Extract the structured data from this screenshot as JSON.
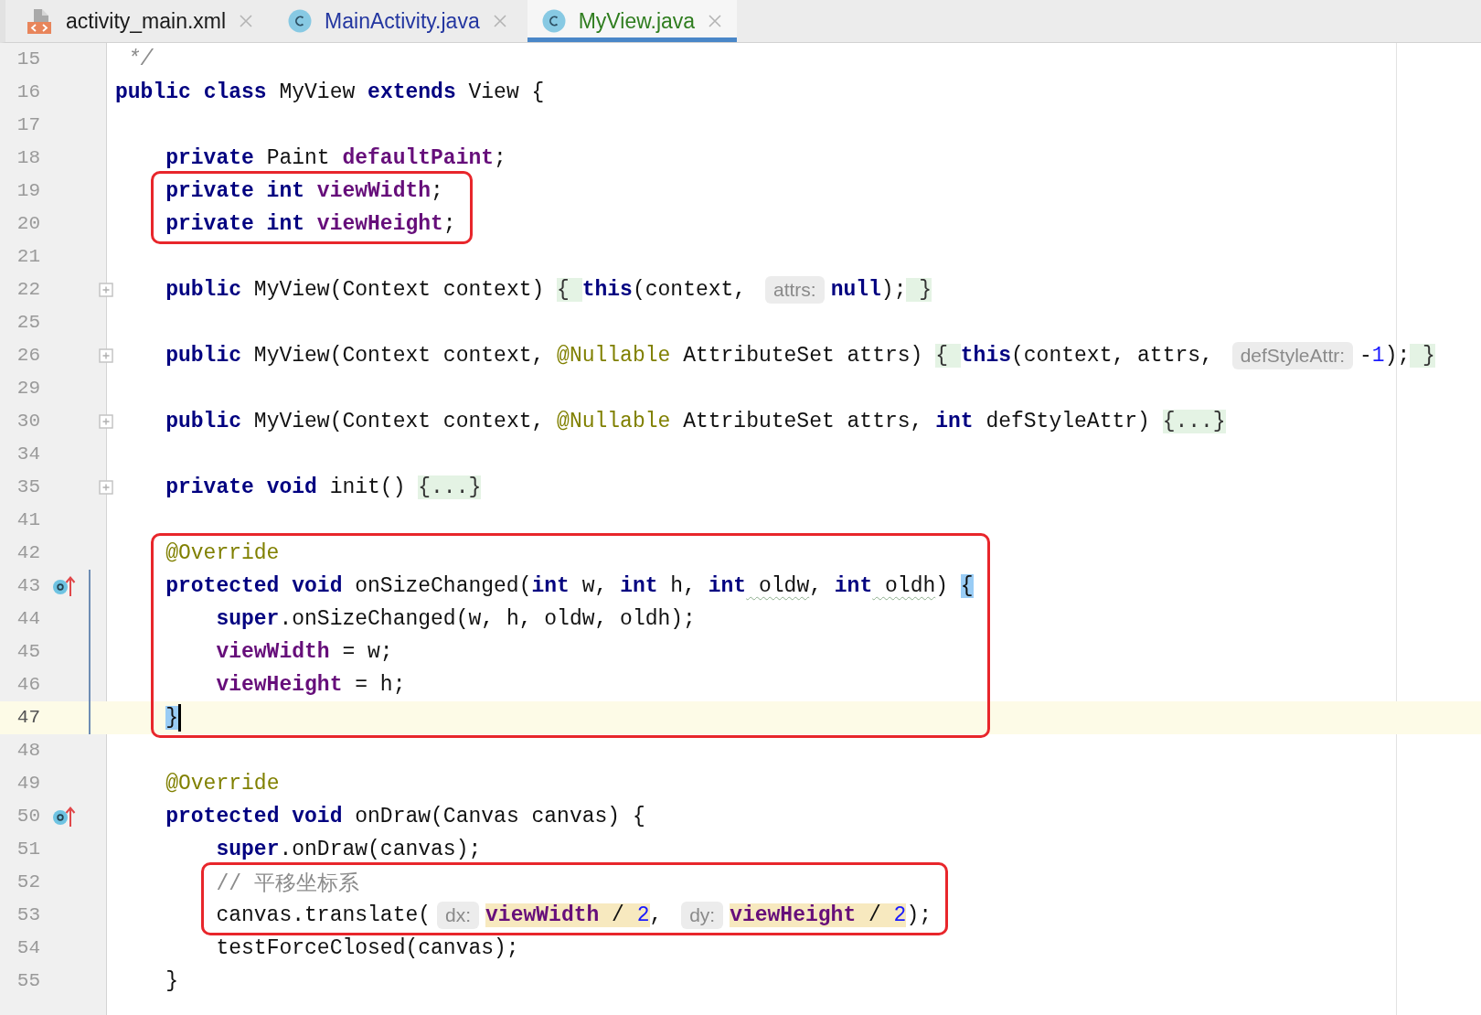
{
  "tabs": [
    {
      "label": "activity_main.xml",
      "kind": "layout",
      "color": "#1a1a1a",
      "selected": false
    },
    {
      "label": "MainActivity.java",
      "kind": "class",
      "color": "#2336a0",
      "selected": false
    },
    {
      "label": "MyView.java",
      "kind": "class",
      "color": "#2f7d1f",
      "selected": true
    }
  ],
  "blocks": [
    {
      "kind": "plain",
      "lines": [
        {
          "number": "15",
          "kind": "fold_end",
          "tokens": [
            {
              "kind": "doc_comment",
              "text": " */"
            }
          ]
        },
        {
          "number": "16",
          "tokens": [
            {
              "kind": "keyword",
              "text": "public"
            },
            {
              "kind": "keyword",
              "text": " class"
            },
            {
              "kind": "plain",
              "text": " MyView "
            },
            {
              "kind": "keyword",
              "text": "extends"
            },
            {
              "kind": "plain",
              "text": " View {"
            }
          ]
        },
        {
          "number": "17"
        },
        {
          "number": "18",
          "tokens": [
            {
              "kind": "keyword",
              "text": "    private"
            },
            {
              "kind": "plain",
              "text": " Paint "
            },
            {
              "kind": "field",
              "text": "defaultPaint"
            },
            {
              "kind": "plain",
              "text": ";"
            }
          ]
        }
      ]
    },
    {
      "kind": "boxed_member",
      "lines": [
        {
          "number": "19",
          "tokens": [
            {
              "kind": "keyword",
              "text": "private int"
            },
            {
              "kind": "field",
              "text": " viewWidth"
            },
            {
              "kind": "plain",
              "text": ";"
            }
          ]
        },
        {
          "number": "20",
          "tokens": [
            {
              "kind": "keyword",
              "text": "private int"
            },
            {
              "kind": "field",
              "text": " viewHeight"
            },
            {
              "kind": "plain",
              "text": ";"
            }
          ]
        }
      ]
    },
    {
      "kind": "plain",
      "lines": [
        {
          "number": "21"
        },
        {
          "number": "22",
          "kind": "collapsed",
          "tokens": [
            {
              "kind": "keyword",
              "text": "    public"
            },
            {
              "kind": "plain",
              "text": " MyView(Context context) "
            },
            {
              "kind": "fold",
              "text": "{ "
            },
            {
              "kind": "keyword",
              "text": "this"
            },
            {
              "kind": "plain",
              "text": "(context, "
            },
            {
              "kind": "hint",
              "text": "attrs:"
            },
            {
              "kind": "keyword",
              "text": "null"
            },
            {
              "kind": "plain",
              "text": ");"
            },
            {
              "kind": "fold",
              "text": " }"
            }
          ]
        },
        {
          "number": "25"
        },
        {
          "number": "26",
          "kind": "collapsed",
          "tokens": [
            {
              "kind": "keyword",
              "text": "    public"
            },
            {
              "kind": "plain",
              "text": " MyView(Context context, "
            },
            {
              "kind": "annotation",
              "text": "@Nullable"
            },
            {
              "kind": "plain",
              "text": " AttributeSet attrs) "
            },
            {
              "kind": "fold",
              "text": "{ "
            },
            {
              "kind": "keyword",
              "text": "this"
            },
            {
              "kind": "plain",
              "text": "(context, attrs, "
            },
            {
              "kind": "hint",
              "text": "defStyleAttr:"
            },
            {
              "kind": "plain",
              "text": "-"
            },
            {
              "kind": "number",
              "text": "1"
            },
            {
              "kind": "plain",
              "text": ");"
            },
            {
              "kind": "fold",
              "text": " }"
            }
          ]
        },
        {
          "number": "29"
        },
        {
          "number": "30",
          "kind": "collapsed",
          "tokens": [
            {
              "kind": "keyword",
              "text": "    public"
            },
            {
              "kind": "plain",
              "text": " MyView(Context context, "
            },
            {
              "kind": "annotation",
              "text": "@Nullable"
            },
            {
              "kind": "plain",
              "text": " AttributeSet attrs, "
            },
            {
              "kind": "keyword",
              "text": "int"
            },
            {
              "kind": "plain",
              "text": " defStyleAttr) "
            },
            {
              "kind": "fold",
              "text": "{...}"
            }
          ]
        },
        {
          "number": "34"
        },
        {
          "number": "35",
          "kind": "collapsed",
          "tokens": [
            {
              "kind": "keyword",
              "text": "    private void"
            },
            {
              "kind": "plain",
              "text": " init() "
            },
            {
              "kind": "fold",
              "text": "{...}"
            }
          ]
        },
        {
          "number": "41"
        }
      ]
    },
    {
      "kind": "boxed_member",
      "lines": [
        {
          "number": "42",
          "tokens": [
            {
              "kind": "annotation",
              "text": "@Override"
            }
          ]
        },
        {
          "number": "43",
          "kind": "fold_start",
          "override": true,
          "changed": true,
          "tokens": [
            {
              "kind": "keyword",
              "text": "protected void"
            },
            {
              "kind": "plain",
              "text": " onSizeChanged("
            },
            {
              "kind": "keyword",
              "text": "int"
            },
            {
              "kind": "plain",
              "text": " w, "
            },
            {
              "kind": "keyword",
              "text": "int"
            },
            {
              "kind": "plain",
              "text": " h, "
            },
            {
              "kind": "keyword",
              "text": "int"
            },
            {
              "kind": "typo",
              "text": " oldw"
            },
            {
              "kind": "plain",
              "text": ", "
            },
            {
              "kind": "keyword",
              "text": "int"
            },
            {
              "kind": "typo",
              "text": " oldh"
            },
            {
              "kind": "plain",
              "text": ") "
            },
            {
              "kind": "brace_match",
              "text": "{"
            }
          ]
        },
        {
          "number": "44",
          "changed": true,
          "tokens": [
            {
              "kind": "keyword",
              "text": "    super"
            },
            {
              "kind": "plain",
              "text": ".onSizeChanged(w, h, oldw, oldh);"
            }
          ]
        },
        {
          "number": "45",
          "changed": true,
          "tokens": [
            {
              "kind": "field",
              "text": "    viewWidth"
            },
            {
              "kind": "plain",
              "text": " = w;"
            }
          ]
        },
        {
          "number": "46",
          "changed": true,
          "tokens": [
            {
              "kind": "field",
              "text": "    viewHeight"
            },
            {
              "kind": "plain",
              "text": " = h;"
            }
          ]
        },
        {
          "number": "47",
          "kind": "fold_end",
          "changed": true,
          "current": true,
          "tokens": [
            {
              "kind": "brace_match",
              "text": "}"
            }
          ]
        }
      ]
    },
    {
      "kind": "plain",
      "lines": [
        {
          "number": "48"
        },
        {
          "number": "49",
          "tokens": [
            {
              "kind": "annotation",
              "text": "    @Override"
            }
          ]
        },
        {
          "number": "50",
          "kind": "fold_start",
          "override": true,
          "tokens": [
            {
              "kind": "keyword",
              "text": "    protected void"
            },
            {
              "kind": "plain",
              "text": " onDraw(Canvas canvas) {"
            }
          ]
        },
        {
          "number": "51",
          "tokens": [
            {
              "kind": "keyword",
              "text": "        super"
            },
            {
              "kind": "plain",
              "text": ".onDraw(canvas);"
            }
          ]
        }
      ]
    },
    {
      "kind": "boxed_statement",
      "lines": [
        {
          "number": "52",
          "tokens": [
            {
              "kind": "comment",
              "text": "// 平移坐标系"
            }
          ]
        },
        {
          "number": "53",
          "tokens": [
            {
              "kind": "plain",
              "text": "canvas.translate("
            },
            {
              "kind": "hint",
              "text": "dx:"
            },
            {
              "kind": "field_hl",
              "text": "viewWidth"
            },
            {
              "kind": "plain_hl",
              "text": " / "
            },
            {
              "kind": "number_hl",
              "text": "2"
            },
            {
              "kind": "plain",
              "text": ", "
            },
            {
              "kind": "hint",
              "text": "dy:"
            },
            {
              "kind": "field_hl",
              "text": "viewHeight"
            },
            {
              "kind": "plain_hl",
              "text": " / "
            },
            {
              "kind": "number_hl",
              "text": "2"
            },
            {
              "kind": "plain",
              "text": ");"
            }
          ]
        }
      ]
    },
    {
      "kind": "plain",
      "lines": [
        {
          "number": "54",
          "tokens": [
            {
              "kind": "plain",
              "text": "        testForceClosed(canvas);"
            }
          ]
        },
        {
          "number": "55",
          "kind": "fold_end",
          "tokens": [
            {
              "kind": "plain",
              "text": "    }"
            }
          ]
        }
      ]
    }
  ]
}
